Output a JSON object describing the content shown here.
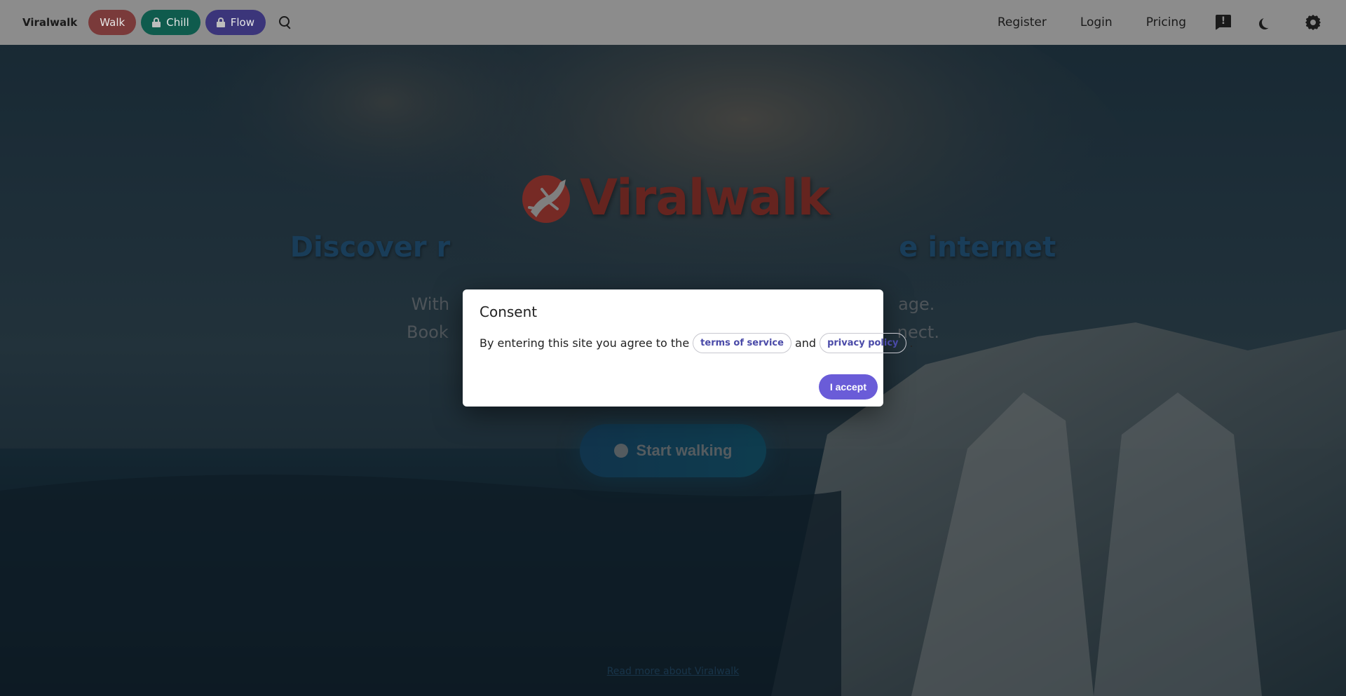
{
  "nav": {
    "brand": "Viralwalk",
    "modes": [
      {
        "label": "Walk"
      },
      {
        "label": "Chill"
      },
      {
        "label": "Flow"
      }
    ],
    "links": {
      "register": "Register",
      "login": "Login",
      "pricing": "Pricing"
    }
  },
  "hero": {
    "logo_text": "Viralwalk",
    "tagline_left": "Discover r",
    "tagline_right": "e internet",
    "desc_line1_left": "With",
    "desc_line1_right": "age.",
    "desc_line2_left": "Book",
    "desc_line2_right": "nect.",
    "start_label": "Start walking",
    "read_more": "Read more about Viralwalk"
  },
  "modal": {
    "title": "Consent",
    "text_before": "By entering this site you agree to the",
    "terms_label": "terms of service",
    "and_text": "and",
    "privacy_label": "privacy policy",
    "period": ".",
    "accept_label": "I accept"
  },
  "colors": {
    "walk": "#e0555a",
    "chill": "#1aa78e",
    "flow": "#6f5ee0",
    "brand_red": "#d84d44",
    "accent_blue": "#3a8fd0",
    "accept": "#6a5cd8"
  }
}
